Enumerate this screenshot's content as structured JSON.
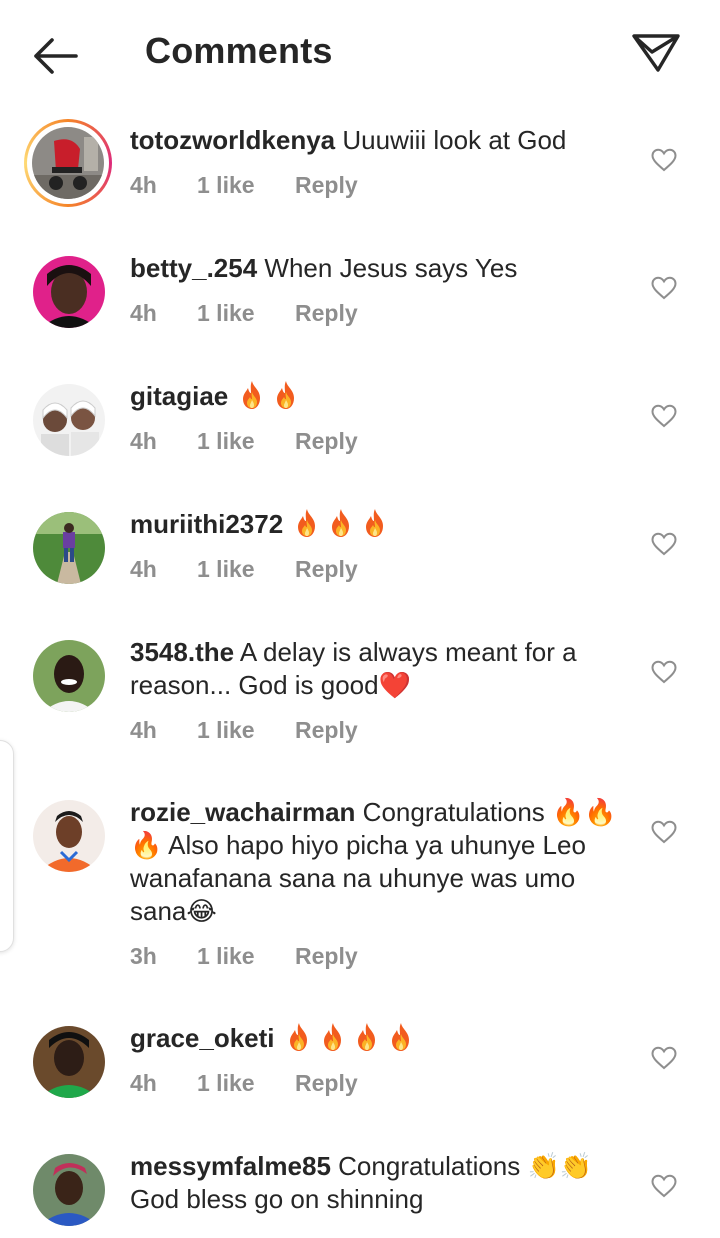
{
  "header": {
    "title": "Comments"
  },
  "comments": [
    {
      "username": "totozworldkenya",
      "text": "Uuuwiii look at God",
      "time": "4h",
      "likes": "1 like",
      "reply": "Reply"
    },
    {
      "username": "betty_.254",
      "text": "When Jesus says Yes",
      "time": "4h",
      "likes": "1 like",
      "reply": "Reply"
    },
    {
      "username": "gitagiae",
      "text": "🔥🔥",
      "time": "4h",
      "likes": "1 like",
      "reply": "Reply"
    },
    {
      "username": "muriithi2372",
      "text": "🔥🔥🔥",
      "time": "4h",
      "likes": "1 like",
      "reply": "Reply"
    },
    {
      "username": "3548.the",
      "text": "A delay is always meant for a reason... God is good❤️",
      "time": "4h",
      "likes": "1 like",
      "reply": "Reply"
    },
    {
      "username": "rozie_wachairman",
      "text": "Congratulations 🔥🔥🔥 Also hapo hiyo picha ya uhunye Leo wanafanana sana na uhunye was umo sana😂",
      "time": "3h",
      "likes": "1 like",
      "reply": "Reply"
    },
    {
      "username": "grace_oketi",
      "text": "🔥🔥🔥🔥",
      "time": "4h",
      "likes": "1 like",
      "reply": "Reply"
    },
    {
      "username": "messymfalme85",
      "text": "Congratulations 👏👏 God bless go on shinning",
      "time": "",
      "likes": "",
      "reply": ""
    }
  ],
  "icons": {
    "back": "arrow-left-icon",
    "share": "paper-plane-icon",
    "like": "heart-outline-icon",
    "fire": "fire-emoji",
    "red_heart": "red-heart-emoji",
    "laugh": "tears-of-joy-emoji",
    "clap": "clapping-hands-emoji"
  },
  "colors": {
    "text_primary": "#262626",
    "text_secondary": "#8e8e8e",
    "story_ring": "#dd2a7b",
    "fire": "#f7941d"
  }
}
